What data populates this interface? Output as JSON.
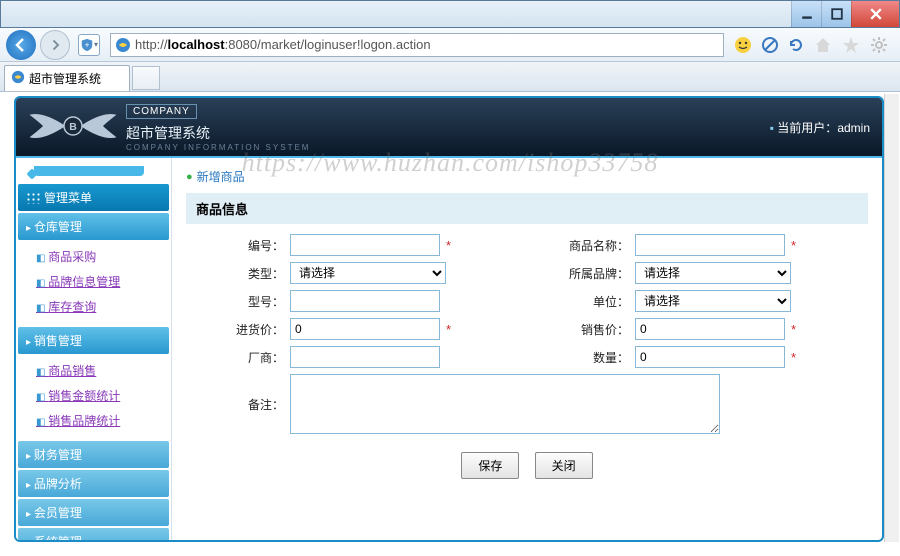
{
  "browser": {
    "url_prefix": "http://",
    "url_host": "localhost",
    "url_rest": ":8080/market/loginuser!logon.action",
    "tab_title": "超市管理系统"
  },
  "header": {
    "company_tag": "COMPANY",
    "app_title": "超市管理系统",
    "app_subtitle": "COMPANY INFORMATION SYSTEM",
    "current_user_label": "当前用户：",
    "current_user": "admin"
  },
  "watermark": "https://www.huzhan.com/ishop33758",
  "sidebar": {
    "menu_title": "管理菜单",
    "groups": [
      {
        "title": "仓库管理",
        "expanded": true,
        "items": [
          "商品采购",
          "品牌信息管理",
          "库存查询"
        ]
      },
      {
        "title": "销售管理",
        "expanded": true,
        "items": [
          "商品销售",
          "销售金额统计",
          "销售品牌统计"
        ]
      },
      {
        "title": "财务管理",
        "expanded": false,
        "items": []
      },
      {
        "title": "品牌分析",
        "expanded": false,
        "items": []
      },
      {
        "title": "会员管理",
        "expanded": false,
        "items": []
      },
      {
        "title": "系统管理",
        "expanded": false,
        "items": []
      }
    ]
  },
  "page": {
    "action_label": "新增商品",
    "panel_title": "商品信息",
    "fields": {
      "code": {
        "label": "编号：",
        "value": "",
        "required": true
      },
      "name": {
        "label": "商品名称：",
        "value": "",
        "required": true
      },
      "type": {
        "label": "类型：",
        "value": "请选择",
        "required": false
      },
      "brand": {
        "label": "所属品牌：",
        "value": "请选择",
        "required": false
      },
      "model": {
        "label": "型号：",
        "value": "",
        "required": false
      },
      "unit": {
        "label": "单位：",
        "value": "请选择",
        "required": false
      },
      "cost": {
        "label": "进货价：",
        "value": "0",
        "required": true
      },
      "price": {
        "label": "销售价：",
        "value": "0",
        "required": true
      },
      "vendor": {
        "label": "厂商：",
        "value": "",
        "required": false
      },
      "qty": {
        "label": "数量：",
        "value": "0",
        "required": true
      },
      "remark": {
        "label": "备注：",
        "value": "",
        "required": false
      }
    },
    "buttons": {
      "save": "保存",
      "close": "关闭"
    }
  }
}
